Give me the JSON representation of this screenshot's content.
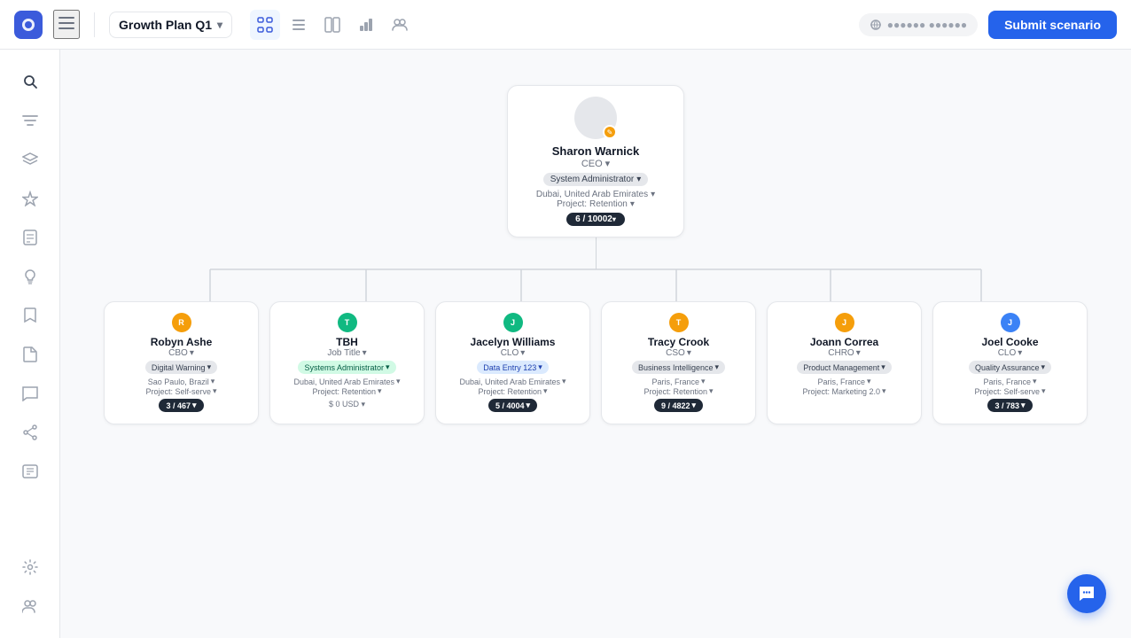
{
  "app": {
    "logo_icon": "☰",
    "plan_name": "Growth Plan Q1",
    "submit_label": "Submit scenario",
    "user_placeholder": "●●●●●● ●●●●●●"
  },
  "toolbar": {
    "views": [
      {
        "id": "tree",
        "icon": "⊞",
        "active": true
      },
      {
        "id": "list",
        "icon": "≡",
        "active": false
      },
      {
        "id": "split",
        "icon": "⊡",
        "active": false
      },
      {
        "id": "chart",
        "icon": "▦",
        "active": false
      },
      {
        "id": "people",
        "icon": "⊕",
        "active": false
      }
    ]
  },
  "sidebar": {
    "items": [
      {
        "id": "search",
        "icon": "🔍"
      },
      {
        "id": "filter",
        "icon": "≡"
      },
      {
        "id": "layers",
        "icon": "⧉"
      },
      {
        "id": "star",
        "icon": "☆"
      },
      {
        "id": "doc",
        "icon": "📄"
      },
      {
        "id": "bulb",
        "icon": "💡"
      },
      {
        "id": "bookmark",
        "icon": "🔖"
      },
      {
        "id": "file",
        "icon": "📁"
      },
      {
        "id": "chat",
        "icon": "💬"
      },
      {
        "id": "share",
        "icon": "↗"
      },
      {
        "id": "list2",
        "icon": "📋"
      },
      {
        "id": "settings",
        "icon": "⚙"
      },
      {
        "id": "users",
        "icon": "👥"
      }
    ]
  },
  "ceo": {
    "name": "Sharon Warnick",
    "title": "CEO",
    "role": "System Administrator",
    "location": "Dubai, United Arab Emirates",
    "project": "Retention",
    "count": "6 / 10002"
  },
  "children": [
    {
      "name": "Robyn Ashe",
      "title": "CBO",
      "badge_color": "orange",
      "badge_letter": "R",
      "role": "Digital Warning",
      "location": "Sao Paulo, Brazil",
      "project": "Self-serve",
      "count": "3 / 467",
      "salary": null
    },
    {
      "name": "TBH",
      "title": "Job Title",
      "badge_color": "green",
      "badge_letter": "T",
      "role": "Systems Administrator",
      "location": "Dubai, United Arab Emirates",
      "project": "Retention",
      "count": null,
      "salary": "$ 0  USD"
    },
    {
      "name": "Jacelyn Williams",
      "title": "CLO",
      "badge_color": "green",
      "badge_letter": "J",
      "role": "Data Entry 123",
      "location": "Dubai, United Arab Emirates",
      "project": "Retention",
      "count": "5 / 4004",
      "salary": null
    },
    {
      "name": "Tracy Crook",
      "title": "CSO",
      "badge_color": "orange",
      "badge_letter": "T",
      "role": "Business Intelligence",
      "location": "Paris, France",
      "project": "Retention",
      "count": "9 / 4822",
      "salary": null
    },
    {
      "name": "Joann Correa",
      "title": "CHRO",
      "badge_color": "orange",
      "badge_letter": "J",
      "role": "Product Management",
      "location": "Paris, France",
      "project": "Marketing 2.0",
      "count": null,
      "salary": null
    },
    {
      "name": "Joel Cooke",
      "title": "CLO",
      "badge_color": "blue",
      "badge_letter": "J",
      "role": "Quality Assurance",
      "location": "Paris, France",
      "project": "Self-serve",
      "count": "3 / 783",
      "salary": null
    }
  ]
}
